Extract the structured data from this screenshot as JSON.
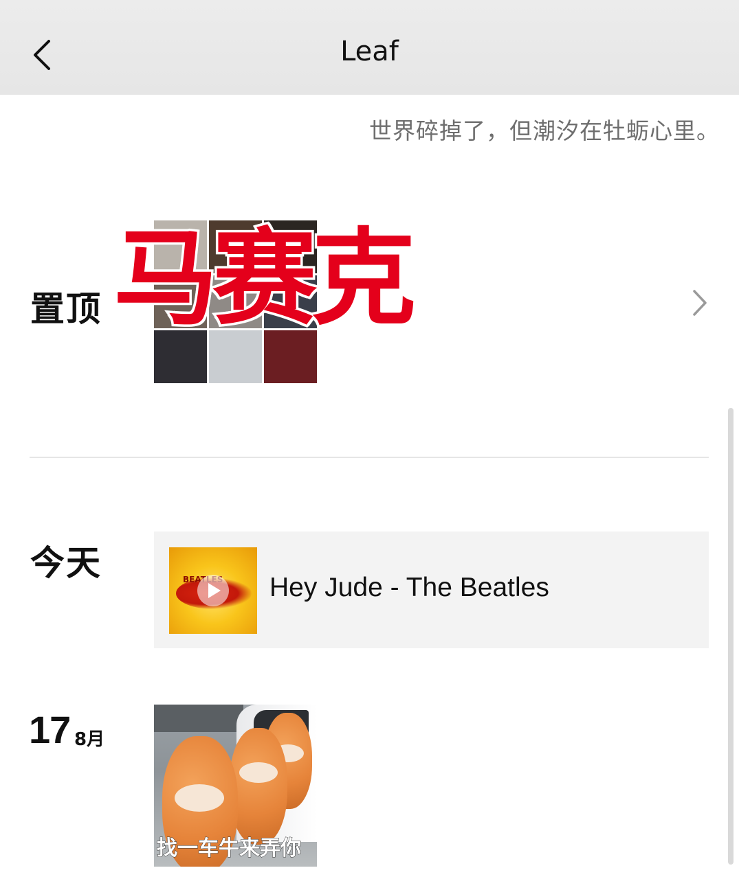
{
  "header": {
    "title": "Leaf"
  },
  "profile": {
    "signature": "世界碎掉了，但潮汐在牡蛎心里。"
  },
  "pinned": {
    "label": "置顶",
    "overlay_sticker": "马赛克",
    "tile_colors": [
      "#b9b3ab",
      "#4e3b2e",
      "#2b2622",
      "#6e6258",
      "#8f8a86",
      "#3a3f4a",
      "#2e2d33",
      "#c9cdd1",
      "#6b1e22"
    ]
  },
  "today": {
    "label": "今天",
    "music": {
      "title": "Hey Jude - The Beatles",
      "album_text": "BEATLES"
    }
  },
  "entry": {
    "day": "17",
    "month": "8月",
    "meme_caption": "找一车牛来弄你"
  },
  "icons": {
    "back": "chevron-left-icon",
    "row_arrow": "chevron-right-icon",
    "play": "play-icon"
  }
}
